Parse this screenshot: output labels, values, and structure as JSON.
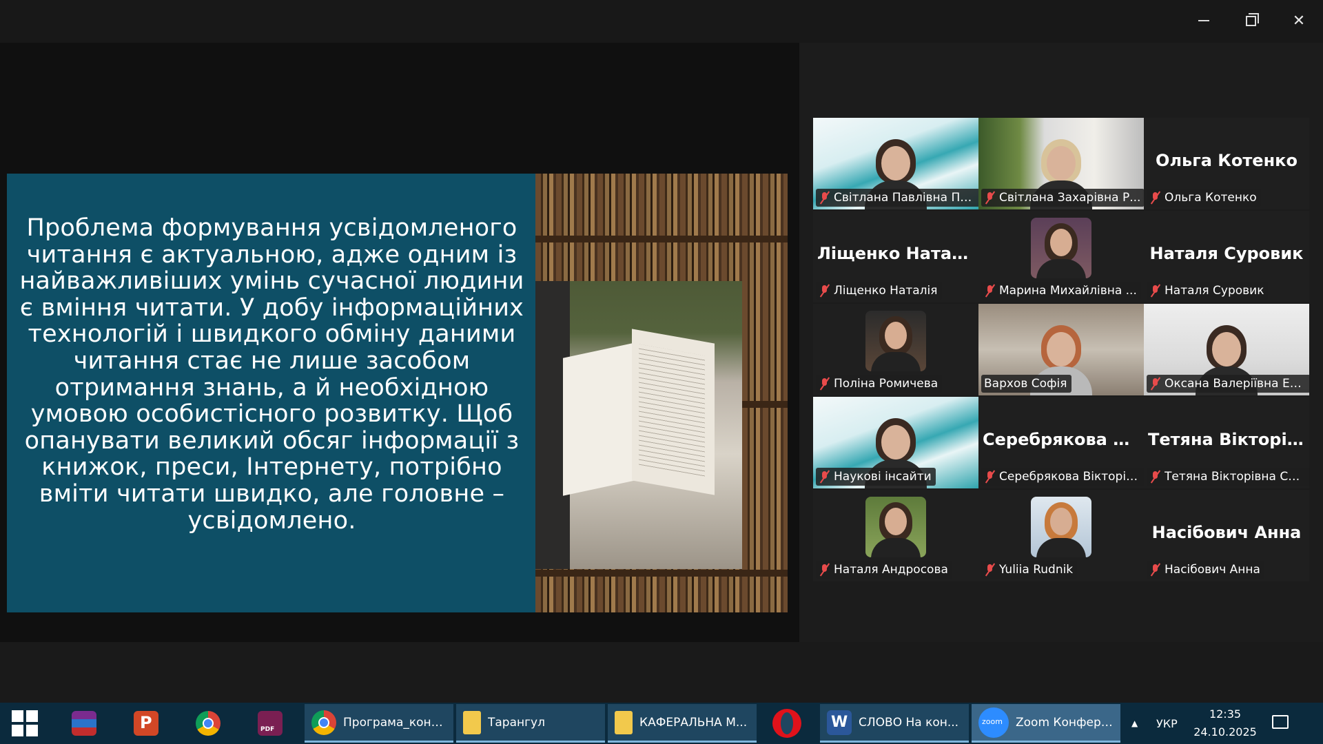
{
  "window": {
    "minimize_label": "—",
    "restore_label": "❐",
    "close_label": "✕"
  },
  "slide": {
    "text": "Проблема формування усвідомленого читання є актуальною, адже одним із найважливіших умінь сучасної людини є вміння читати. У добу інформаційних технологій і швидкого обміну даними читання стає не лише засобом отримання знань, а й необхідною умовою особистісного розвитку. Щоб опанувати великий обсяг інформації з книжок, преси, Інтернету, потрібно вміти читати швидко, але головне – усвідомлено."
  },
  "participants": [
    {
      "label": "Світлана Павлівна Па...",
      "big_name": "",
      "kind": "video-teal"
    },
    {
      "label": "Світлана Захарівна Р...",
      "big_name": "",
      "kind": "video-plant"
    },
    {
      "label": "Ольга Котенко",
      "big_name": "Ольга Котенко",
      "kind": "name"
    },
    {
      "label": "Ліщенко Наталія",
      "big_name": "Ліщенко Наталія",
      "kind": "name"
    },
    {
      "label": "Марина Михайлівна ...",
      "big_name": "",
      "kind": "avatar-purple"
    },
    {
      "label": "Наталя Суровик",
      "big_name": "Наталя Суровик",
      "kind": "name"
    },
    {
      "label": "Поліна Ромичева",
      "big_name": "",
      "kind": "avatar-dark"
    },
    {
      "label": "Вархов Софія",
      "big_name": "",
      "kind": "video-room"
    },
    {
      "label": "Оксана Валеріївна Ел...",
      "big_name": "",
      "kind": "video-white"
    },
    {
      "label": "Наукові інсайти",
      "big_name": "",
      "kind": "video-teal"
    },
    {
      "label": "Серебрякова Вікторія...",
      "big_name": "Серебрякова В...",
      "kind": "name"
    },
    {
      "label": "Тетяна Вікторівна См...",
      "big_name": "Тетяна Вікторів...",
      "kind": "name"
    },
    {
      "label": "Наталя Андросова",
      "big_name": "",
      "kind": "avatar-green"
    },
    {
      "label": "Yuliia Rudnik",
      "big_name": "",
      "kind": "avatar-blue"
    },
    {
      "label": "Насібович Анна",
      "big_name": "Насібович Анна",
      "kind": "name"
    }
  ],
  "taskbar": {
    "apps": [
      {
        "label": "Програма_конф...",
        "icon": "chrome-icon"
      },
      {
        "label": "Тарангул",
        "icon": "folder-icon"
      },
      {
        "label": "КАФЕРАЛЬНА М...",
        "icon": "folder-icon"
      },
      {
        "label": "СЛОВО На кон...",
        "icon": "word-icon"
      },
      {
        "label": "Zoom Конфере...",
        "icon": "zoom-icon"
      }
    ],
    "tray_arrow": "▲",
    "language": "УКР",
    "time": "12:35",
    "date": "24.10.2025"
  },
  "colors": {
    "slide_bg": "#0e4f66",
    "active_speaker": "#29d36b",
    "taskbar_bg": "#0b2a3d",
    "muted_mic": "#e84b4b"
  }
}
